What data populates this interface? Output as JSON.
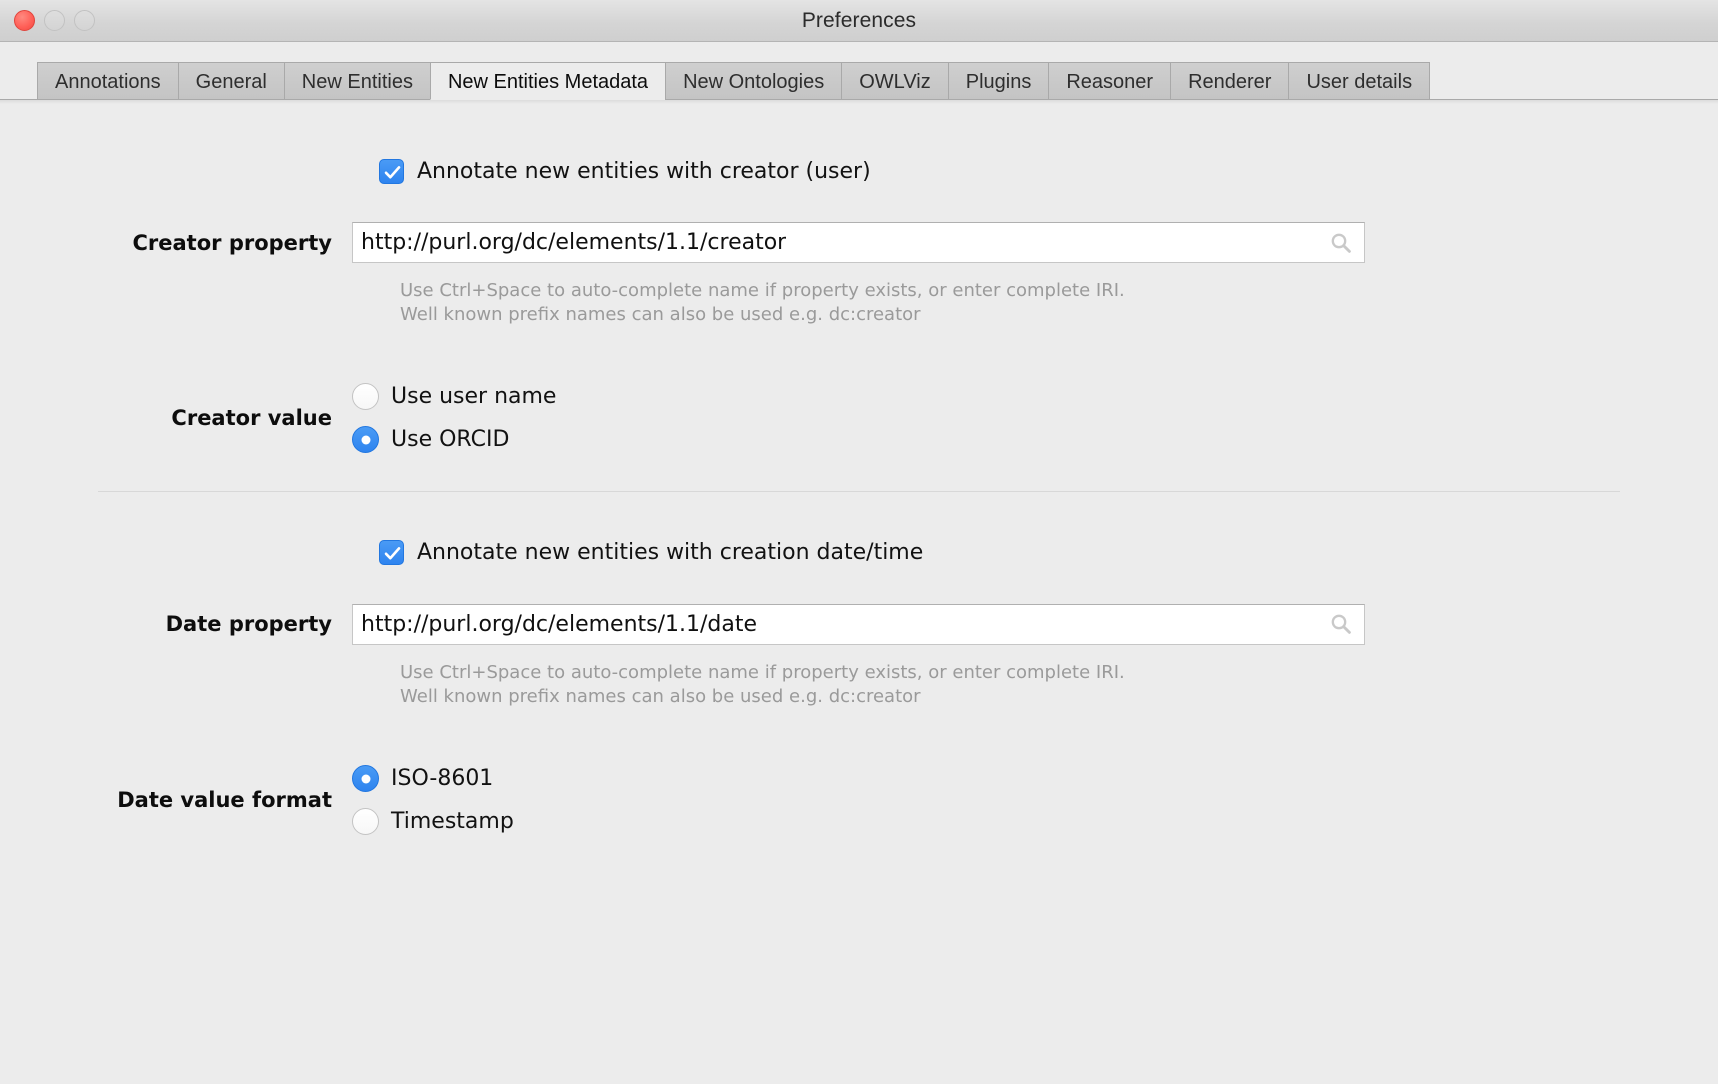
{
  "window": {
    "title": "Preferences",
    "traffic_lights": [
      "close",
      "minimize",
      "maximize"
    ],
    "accent_color": "#3a8ef0",
    "background_color": "#ececec"
  },
  "tabs": [
    {
      "label": "Annotations",
      "active": false
    },
    {
      "label": "General",
      "active": false
    },
    {
      "label": "New Entities",
      "active": false
    },
    {
      "label": "New Entities Metadata",
      "active": true
    },
    {
      "label": "New Ontologies",
      "active": false
    },
    {
      "label": "OWLViz",
      "active": false
    },
    {
      "label": "Plugins",
      "active": false
    },
    {
      "label": "Reasoner",
      "active": false
    },
    {
      "label": "Renderer",
      "active": false
    },
    {
      "label": "User details",
      "active": false
    }
  ],
  "creator_section": {
    "checkbox_label": "Annotate new entities with creator (user)",
    "checkbox_checked": true,
    "property_label": "Creator property",
    "property_value": "http://purl.org/dc/elements/1.1/creator",
    "property_search_icon": "search-icon",
    "hint_line_1": "Use Ctrl+Space to auto-complete name if property exists, or enter complete IRI.",
    "hint_line_2": "Well known prefix names can also be used e.g. dc:creator",
    "value_label": "Creator value",
    "options": [
      {
        "label": "Use user name",
        "selected": false
      },
      {
        "label": "Use ORCID",
        "selected": true
      }
    ]
  },
  "date_section": {
    "checkbox_label": "Annotate new entities with creation date/time",
    "checkbox_checked": true,
    "property_label": "Date property",
    "property_value": "http://purl.org/dc/elements/1.1/date",
    "property_search_icon": "search-icon",
    "hint_line_1": "Use Ctrl+Space to auto-complete name if property exists, or enter complete IRI.",
    "hint_line_2": "Well known prefix names can also be used e.g. dc:creator",
    "format_label": "Date value format",
    "options": [
      {
        "label": "ISO-8601",
        "selected": true
      },
      {
        "label": "Timestamp",
        "selected": false
      }
    ]
  }
}
